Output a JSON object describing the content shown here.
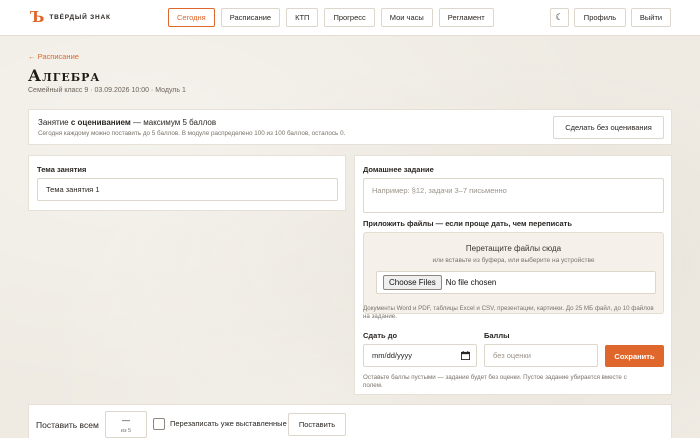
{
  "logo": {
    "mark": "Ъ",
    "text": "ТВЁРДЫЙ ЗНАК"
  },
  "nav": {
    "items": [
      {
        "label": "Сегодня",
        "active": true
      },
      {
        "label": "Расписание",
        "active": false
      },
      {
        "label": "КТП",
        "active": false
      },
      {
        "label": "Прогресс",
        "active": false
      },
      {
        "label": "Мои часы",
        "active": false
      },
      {
        "label": "Регламент",
        "active": false
      }
    ],
    "theme_icon": "moon-icon",
    "theme_glyph": "☾",
    "profile_label": "Профиль",
    "logout_label": "Выйти"
  },
  "header": {
    "back_link": "← Расписание",
    "title": "Алгебра",
    "subtitle": "Семейный класс 9 · 03.09.2026 10:00 · Модуль 1"
  },
  "grading": {
    "prefix": "Занятие ",
    "bold": "с оцениванием",
    "suffix": " — максимум 5 баллов",
    "details": "Сегодня каждому можно поставить до 5 баллов. В модуле распределено 100 из 100 баллов, осталось 0.",
    "no_grade_button": "Сделать без оценивания"
  },
  "topic": {
    "label": "Тема занятия",
    "value": "Тема занятия 1"
  },
  "homework": {
    "label": "Домашнее задание",
    "placeholder": "Например: §12, задачи 3–7 письменно",
    "attach_label": "Приложить файлы — если проще дать, чем переписать",
    "drop_title": "Перетащите файлы сюда",
    "drop_sub": "или вставьте из буфера, или выберите на устройстве",
    "file_button": "Choose Files",
    "file_status": "No file chosen",
    "file_hint_1": "Документы Word и PDF, таблицы Excel и CSV, презентации, картинки. До 25 МБ файл, до 10 файлов",
    "file_hint_2": "на задание.",
    "due_label": "Сдать до",
    "due_placeholder": "mm/dd/yyyy",
    "points_label": "Баллы",
    "points_placeholder": "без оценки",
    "save_button": "Сохранить",
    "points_hint_1": "Оставьте баллы пустыми — задание будет без оценки. Пустое задание убирается вместе с",
    "points_hint_2": "полем."
  },
  "bulk": {
    "label": "Поставить всем",
    "value": "—",
    "of_label": "из 5",
    "overwrite_label": "Перезаписать уже выставленные",
    "apply_button": "Поставить"
  },
  "colors": {
    "accent": "#e0672c",
    "background": "#efebe3",
    "card": "#ffffff"
  }
}
